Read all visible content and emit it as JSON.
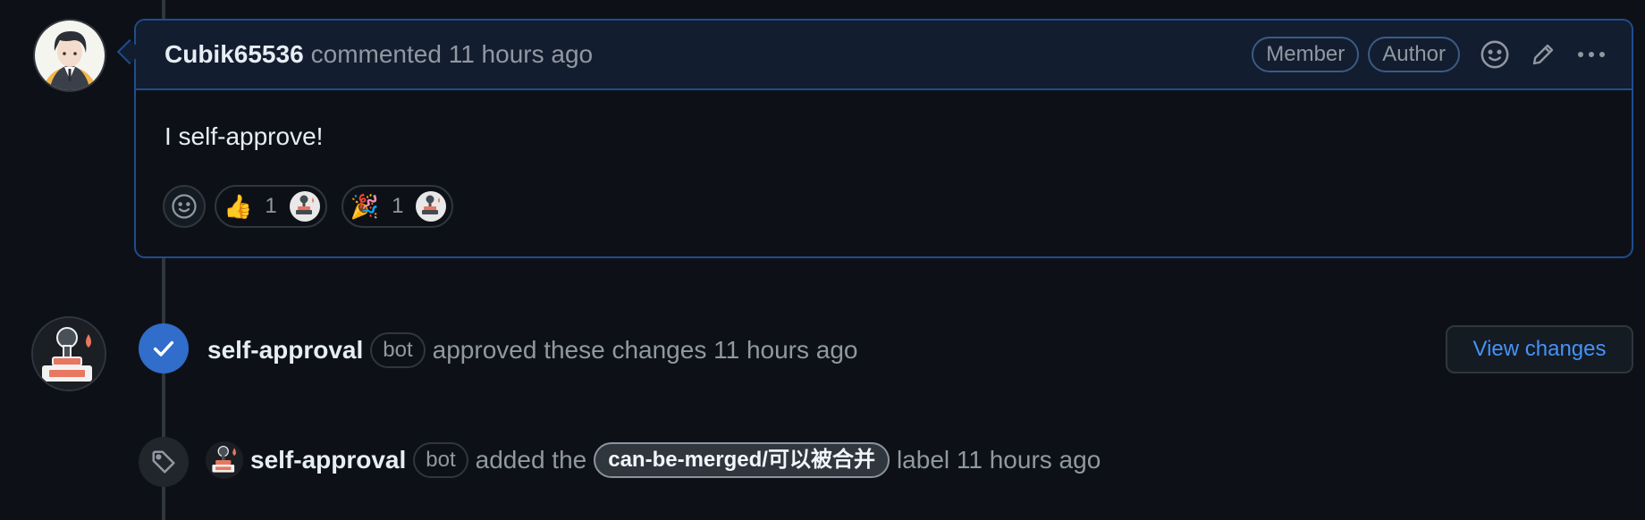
{
  "comment": {
    "author": "Cubik65536",
    "meta": "commented 11 hours ago",
    "badges": [
      "Member",
      "Author"
    ],
    "body": "I self-approve!",
    "reactions": [
      {
        "emoji": "👍",
        "count": "1"
      },
      {
        "emoji": "🎉",
        "count": "1"
      }
    ]
  },
  "approval": {
    "actor": "self-approval",
    "tag": "bot",
    "text": "approved these changes 11 hours ago",
    "button": "View changes"
  },
  "labeled": {
    "actor": "self-approval",
    "tag": "bot",
    "pre": "added the",
    "label": "can-be-merged/可以被合并",
    "post": "label 11 hours ago"
  },
  "colors": {
    "accent": "#316dca",
    "link": "#4493f8",
    "comment_border": "#1f4d8f",
    "background": "#0d1117"
  }
}
